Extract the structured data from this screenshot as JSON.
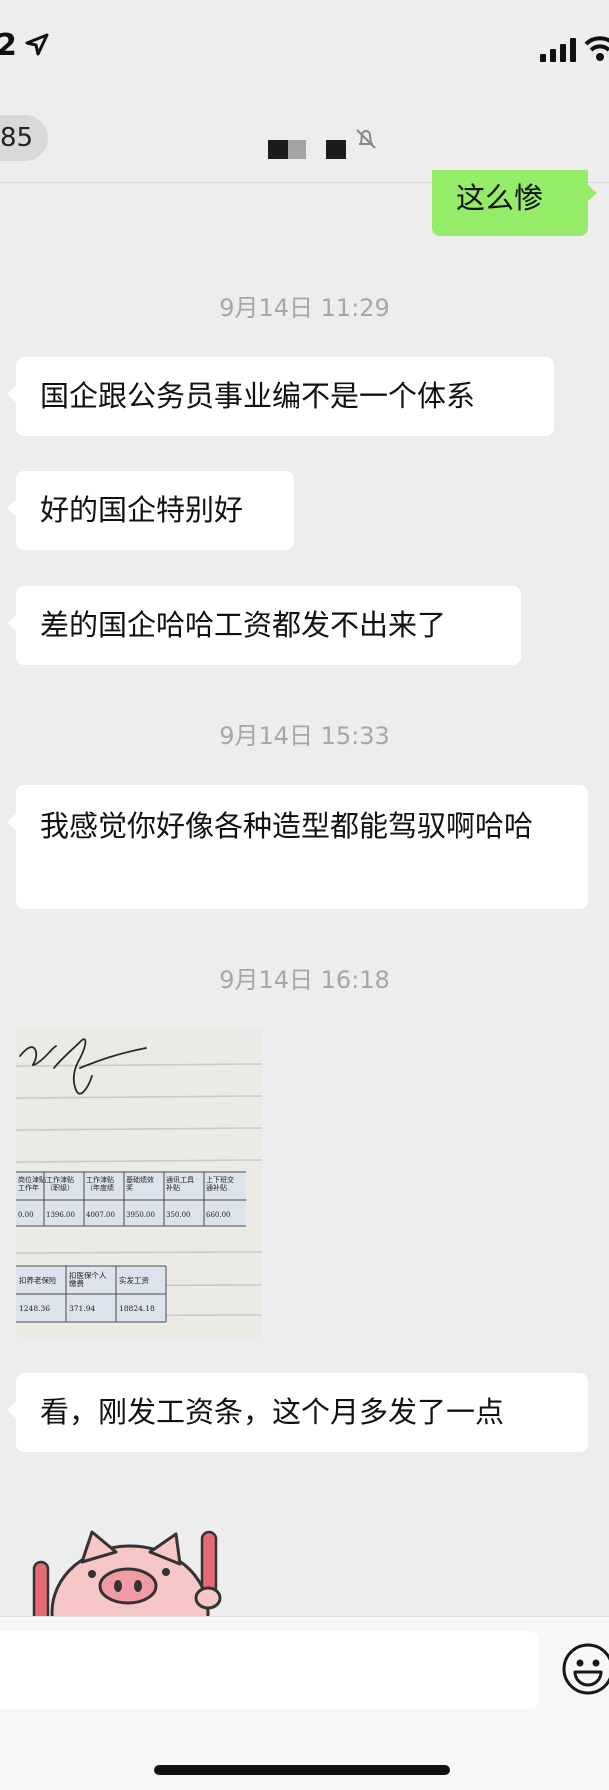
{
  "status_bar": {
    "time": "2"
  },
  "header": {
    "back_count": "85",
    "mute_icon": "mute-bell-icon"
  },
  "messages": [
    {
      "type": "outgoing",
      "text": "这么惨"
    },
    {
      "type": "timestamp",
      "text": "9月14日 11:29"
    },
    {
      "type": "incoming",
      "text": "国企跟公务员事业编不是一个体系"
    },
    {
      "type": "incoming",
      "text": "好的国企特别好"
    },
    {
      "type": "incoming",
      "text": "差的国企哈哈工资都发不出来了"
    },
    {
      "type": "timestamp",
      "text": "9月14日 15:33"
    },
    {
      "type": "incoming",
      "text": "我感觉你好像各种造型都能驾驭啊哈哈"
    },
    {
      "type": "timestamp",
      "text": "9月14日 16:18"
    },
    {
      "type": "image",
      "description": "photo-payslip"
    },
    {
      "type": "incoming",
      "text": "看，刚发工资条，这个月多发了一点"
    },
    {
      "type": "sticker",
      "description": "pig-sticker"
    }
  ],
  "payslip": {
    "row1_headers": [
      "岗位津贴\n工作年",
      "工作津贴\n（职级）",
      "工作津贴\n（年度绩",
      "基础绩效\n奖",
      "通讯工具\n补贴",
      "上下班交\n通补贴"
    ],
    "row1_values": [
      "0.00",
      "1396.00",
      "4007.00",
      "3950.00",
      "350.00",
      "660.00"
    ],
    "row2_headers": [
      "扣养老保险",
      "扣医保个人\n缴费",
      "实发工资"
    ],
    "row2_values": [
      "1248.36",
      "371.94",
      "18824.18"
    ]
  },
  "input_bar": {
    "emoji_icon": "emoji-smile-icon"
  }
}
